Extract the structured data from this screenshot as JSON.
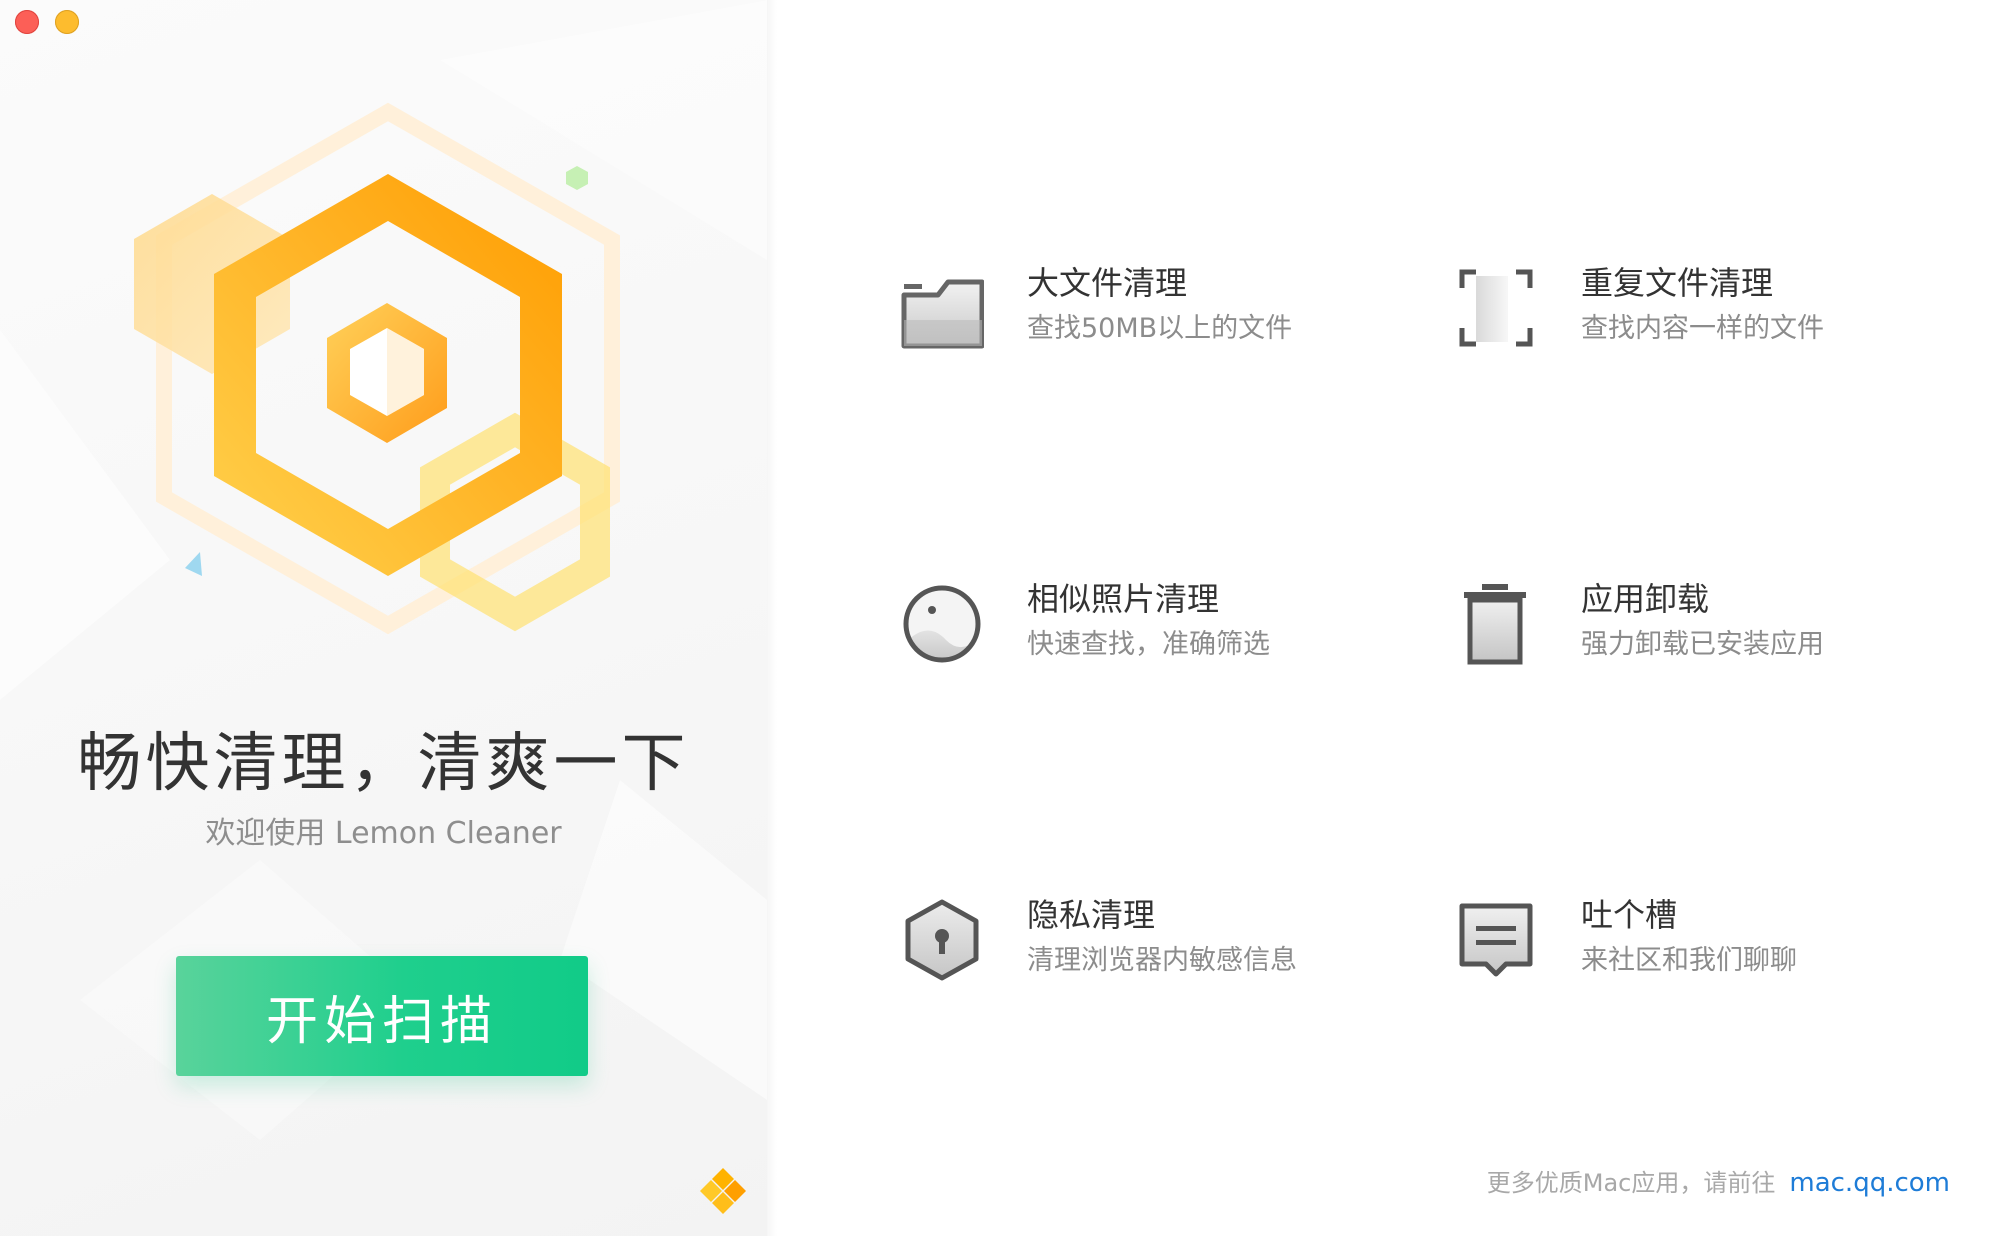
{
  "window": {
    "controls": [
      "close",
      "minimize"
    ]
  },
  "hero": {
    "headline": "畅快清理，清爽一下",
    "subheadline": "欢迎使用 Lemon Cleaner",
    "start_button_label": "开始扫描"
  },
  "features": [
    {
      "icon": "folder-icon",
      "title": "大文件清理",
      "desc": "查找50MB以上的文件"
    },
    {
      "icon": "duplicate-files-icon",
      "title": "重复文件清理",
      "desc": "查找内容一样的文件"
    },
    {
      "icon": "photo-icon",
      "title": "相似照片清理",
      "desc": "快速查找，准确筛选"
    },
    {
      "icon": "trash-icon",
      "title": "应用卸载",
      "desc": "强力卸载已安装应用"
    },
    {
      "icon": "privacy-lock-icon",
      "title": "隐私清理",
      "desc": "清理浏览器内敏感信息"
    },
    {
      "icon": "feedback-icon",
      "title": "吐个槽",
      "desc": "来社区和我们聊聊"
    }
  ],
  "footer": {
    "text": "更多优质Mac应用，请前往",
    "link": "mac.qq.com"
  },
  "colors": {
    "accent_green": "#1fcf8d",
    "accent_orange": "#ffa200",
    "link_blue": "#1e7cd7",
    "traffic_close": "#fc5f57",
    "traffic_minimize": "#fdbc2e"
  }
}
